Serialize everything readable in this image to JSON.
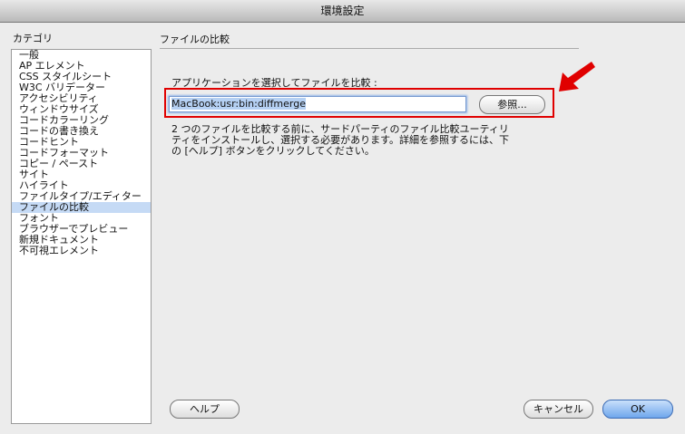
{
  "window": {
    "title": "環境設定"
  },
  "sidebar": {
    "label": "カテゴリ",
    "items": [
      "一般",
      "AP エレメント",
      "CSS スタイルシート",
      "W3C バリデーター",
      "アクセシビリティ",
      "ウィンドウサイズ",
      "コードカラーリング",
      "コードの書き換え",
      "コードヒント",
      "コードフォーマット",
      "コピー / ペースト",
      "サイト",
      "ハイライト",
      "ファイルタイプ/エディター",
      "ファイルの比較",
      "フォント",
      "ブラウザーでプレビュー",
      "新規ドキュメント",
      "不可視エレメント"
    ],
    "selected_index": 14
  },
  "panel": {
    "title": "ファイルの比較",
    "field_label": "アプリケーションを選択してファイルを比較 :",
    "field_value": "MacBook:usr:bin:diffmerge",
    "browse_label": "参照...",
    "description": [
      "2 つのファイルを比較する前に、サードパーティのファイル比較ユーティリ",
      "ティをインストールし、選択する必要があります。詳細を参照するには、下",
      "の [ヘルプ] ボタンをクリックしてください。"
    ]
  },
  "footer": {
    "help_label": "ヘルプ",
    "cancel_label": "キャンセル",
    "ok_label": "OK"
  },
  "colors": {
    "highlight": "#e00000",
    "selection": "#c5daf5"
  }
}
